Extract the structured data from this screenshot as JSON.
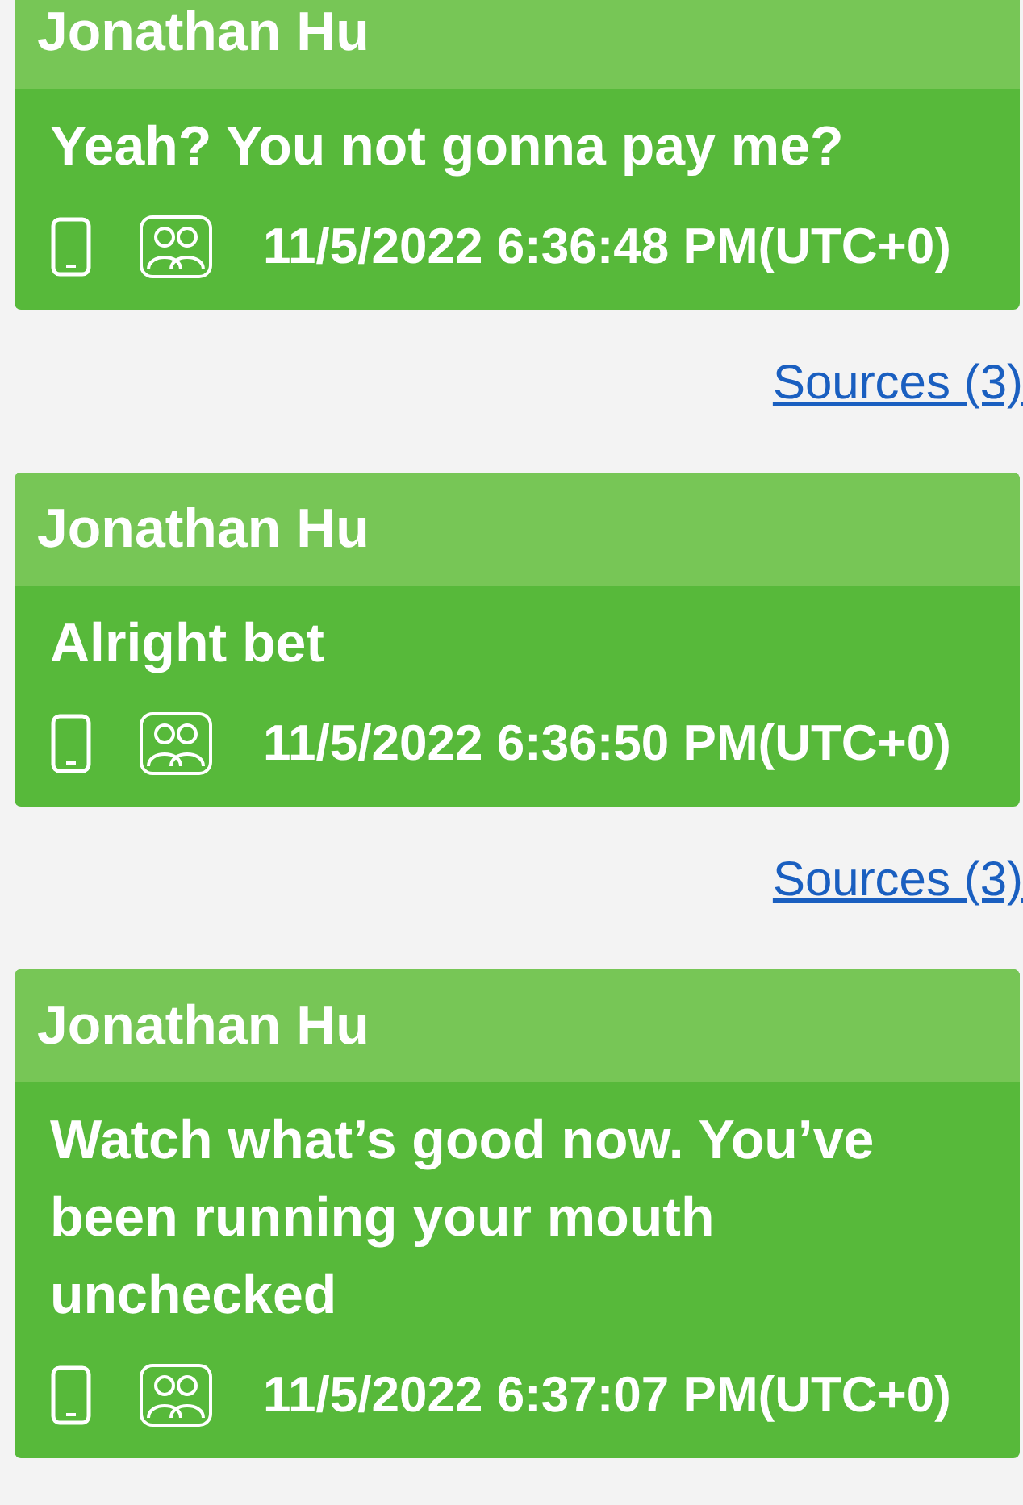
{
  "messages": [
    {
      "sender": "Jonathan Hu",
      "text": "Yeah? You not gonna pay me?",
      "timestamp": "11/5/2022 6:36:48 PM(UTC+0)",
      "sources_link": "Sources (3)"
    },
    {
      "sender": "Jonathan Hu",
      "text": "Alright bet",
      "timestamp": "11/5/2022 6:36:50 PM(UTC+0)",
      "sources_link": "Sources (3)"
    },
    {
      "sender": "Jonathan Hu",
      "text": "Watch what’s good now. You’ve been running your mouth unchecked",
      "timestamp": "11/5/2022 6:37:07 PM(UTC+0)"
    }
  ]
}
